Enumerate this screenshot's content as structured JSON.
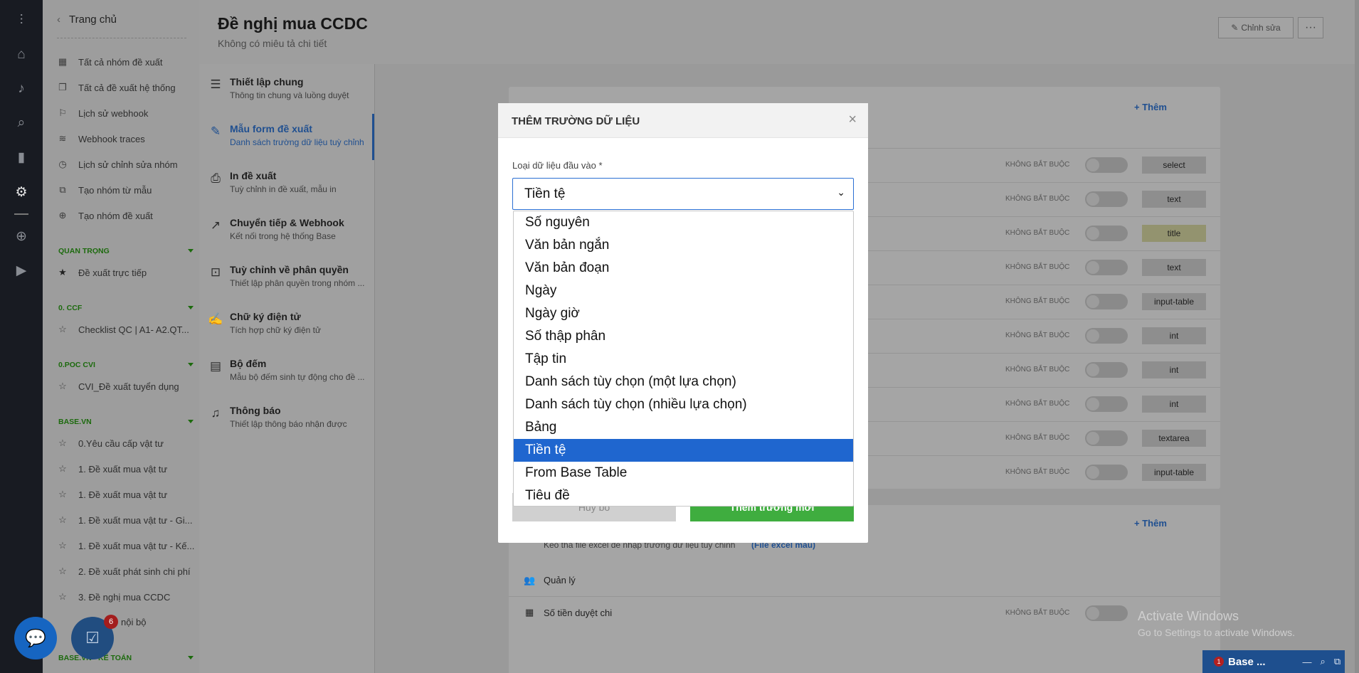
{
  "sidebar": {
    "home": "Trang chủ",
    "items": [
      {
        "label": "Tất cả nhóm đề xuất",
        "icon": "grid-icon"
      },
      {
        "label": "Tất cả đề xuất hệ thống",
        "icon": "copy-icon"
      },
      {
        "label": "Lịch sử webhook",
        "icon": "flag-icon"
      },
      {
        "label": "Webhook traces",
        "icon": "layers-icon"
      },
      {
        "label": "Lịch sử chỉnh sửa nhóm",
        "icon": "clock-icon"
      },
      {
        "label": "Tạo nhóm từ mẫu",
        "icon": "template-icon"
      },
      {
        "label": "Tạo nhóm đề xuất",
        "icon": "plus-circle-icon"
      }
    ],
    "sections": [
      {
        "title": "QUAN TRỌNG",
        "items": [
          "Đề xuất trực tiếp"
        ]
      },
      {
        "title": "0. CCF",
        "items": [
          "Checklist QC | A1- A2.QT..."
        ]
      },
      {
        "title": "0.POC CVI",
        "items": [
          "CVI_Đề xuất tuyển dụng"
        ]
      },
      {
        "title": "BASE.VN",
        "items": [
          "0.Yêu cầu cấp vật tư",
          "1. Đề xuất mua vật tư",
          "1. Đề xuất mua vật tư",
          "1. Đề xuất mua vật tư - Gi...",
          "1. Đề xuất mua vật tư - Kế...",
          "2. Đề xuất phát sinh chi phí",
          "3. Đề nghị mua CCDC",
          "nội bộ"
        ]
      },
      {
        "title": "BASE.VN - KẾ TOÁN",
        "items": []
      }
    ]
  },
  "header": {
    "title": "Đề nghị mua CCDC",
    "subtitle": "Không có miêu tả chi tiết",
    "edit": "Chỉnh sửa",
    "more": "···"
  },
  "settings": [
    {
      "title": "Thiết lập chung",
      "sub": "Thông tin chung và luồng duyệt",
      "icon": "document-icon"
    },
    {
      "title": "Mẫu form đề xuất",
      "sub": "Danh sách trường dữ liệu tuỳ chỉnh",
      "icon": "edit-icon"
    },
    {
      "title": "In đề xuất",
      "sub": "Tuỳ chỉnh in đề xuất, mẫu in",
      "icon": "printer-icon"
    },
    {
      "title": "Chuyển tiếp & Webhook",
      "sub": "Kết nối trong hệ thống Base",
      "icon": "share-icon"
    },
    {
      "title": "Tuỳ chỉnh về phân quyền",
      "sub": "Thiết lập phân quyền trong nhóm ...",
      "icon": "permission-icon"
    },
    {
      "title": "Chữ ký điện tử",
      "sub": "Tích hợp chữ ký điện tử",
      "icon": "signature-icon"
    },
    {
      "title": "Bộ đếm",
      "sub": "Mẫu bộ đếm sinh tự động cho đề ...",
      "icon": "counter-icon"
    },
    {
      "title": "Thông báo",
      "sub": "Thiết lập thông báo nhận được",
      "icon": "bell-icon"
    }
  ],
  "background": {
    "add_label": "+ Thêm",
    "optional": "KHÔNG BẮT BUỘC",
    "rows": [
      "select",
      "text",
      "title",
      "text",
      "input-table",
      "int",
      "int",
      "int",
      "textarea",
      "input-table"
    ],
    "excel_hint": "Kéo thả file excel để nhập trường dữ liệu tuỳ chỉnh",
    "excel_link": "(File excel mẫu)",
    "section_manager": "Quản lý",
    "row_amount": "Số tiền duyệt chi"
  },
  "modal": {
    "title": "THÊM TRƯỜNG DỮ LIỆU",
    "close": "×",
    "field_label": "Loại dữ liệu đầu vào *",
    "selected": "Tiền tệ",
    "options": [
      "Số nguyên",
      "Văn bản ngắn",
      "Văn bản đoạn",
      "Ngày",
      "Ngày giờ",
      "Số thập phân",
      "Tập tin",
      "Danh sách tùy chọn (một lựa chọn)",
      "Danh sách tùy chọn (nhiều lựa chọn)",
      "Bảng",
      "Tiền tệ",
      "From Base Table",
      "Tiêu đề"
    ],
    "cancel": "Hủy bỏ",
    "submit": "Thêm trường mới"
  },
  "chat_badge": "6",
  "windows": {
    "title": "Activate Windows",
    "sub": "Go to Settings to activate Windows."
  },
  "basebar": {
    "badge": "1",
    "label": "Base ..."
  }
}
